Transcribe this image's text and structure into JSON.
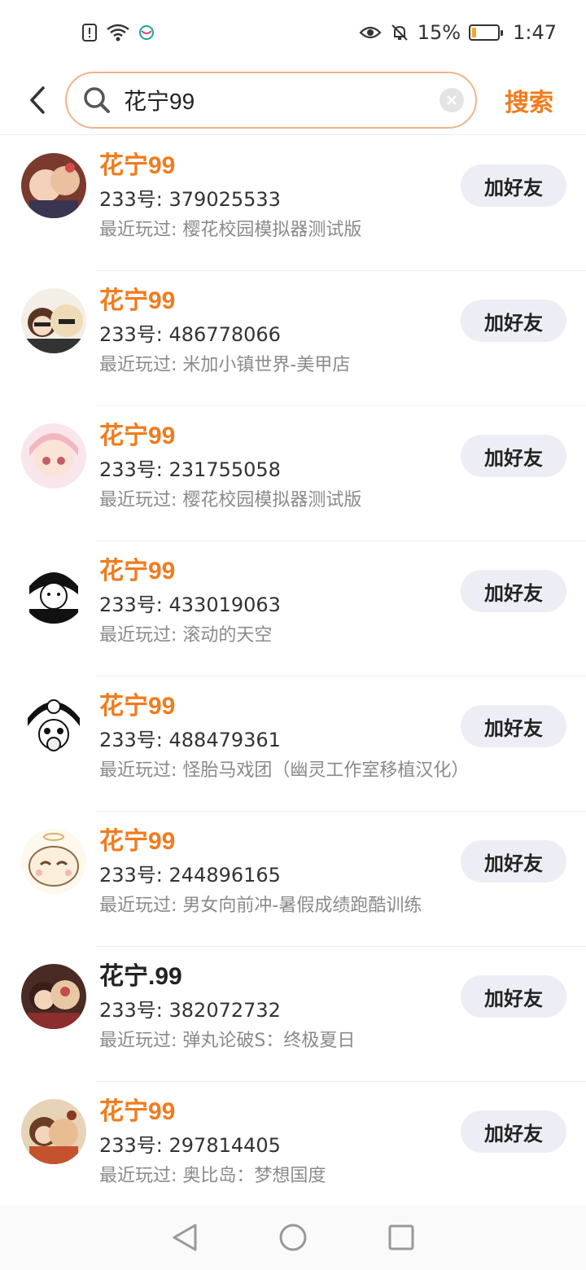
{
  "status_bar": {
    "battery_percent": "15%",
    "time": "1:47",
    "battery_level": 0.15,
    "icons": [
      "alert-icon",
      "wifi-icon",
      "network-logo-icon",
      "eye-icon",
      "bell-off-icon",
      "battery-icon"
    ]
  },
  "search": {
    "query": "花宁99",
    "action_label": "搜索",
    "border_color": "#f0b48a"
  },
  "accent_color": "#f07c1e",
  "results": [
    {
      "name": "花宁99",
      "uid": "233号: 379025533",
      "recent": "最近玩过: 樱花校园模拟器测试版",
      "button": "加好友",
      "highlight": true
    },
    {
      "name": "花宁99",
      "uid": "233号: 486778066",
      "recent": "最近玩过: 米加小镇世界-美甲店",
      "button": "加好友",
      "highlight": true
    },
    {
      "name": "花宁99",
      "uid": "233号: 231755058",
      "recent": "最近玩过: 樱花校园模拟器测试版",
      "button": "加好友",
      "highlight": true
    },
    {
      "name": "花宁99",
      "uid": "233号: 433019063",
      "recent": "最近玩过: 滚动的天空",
      "button": "加好友",
      "highlight": true
    },
    {
      "name": "花宁99",
      "uid": "233号: 488479361",
      "recent": "最近玩过: 怪胎马戏团（幽灵工作室移植汉化）",
      "button": "加好友",
      "highlight": true
    },
    {
      "name": "花宁99",
      "uid": "233号: 244896165",
      "recent": "最近玩过: 男女向前冲-暑假成绩跑酷训练",
      "button": "加好友",
      "highlight": true
    },
    {
      "name": "花宁.99",
      "uid": "233号: 382072732",
      "recent": "最近玩过: 弹丸论破S：终极夏日",
      "button": "加好友",
      "highlight": false
    },
    {
      "name": "花宁99",
      "uid": "233号: 297814405",
      "recent": "最近玩过: 奥比岛：梦想国度",
      "button": "加好友",
      "highlight": true
    }
  ],
  "nav_bar": {
    "icons": [
      "back-triangle-icon",
      "home-circle-icon",
      "recents-square-icon"
    ]
  }
}
